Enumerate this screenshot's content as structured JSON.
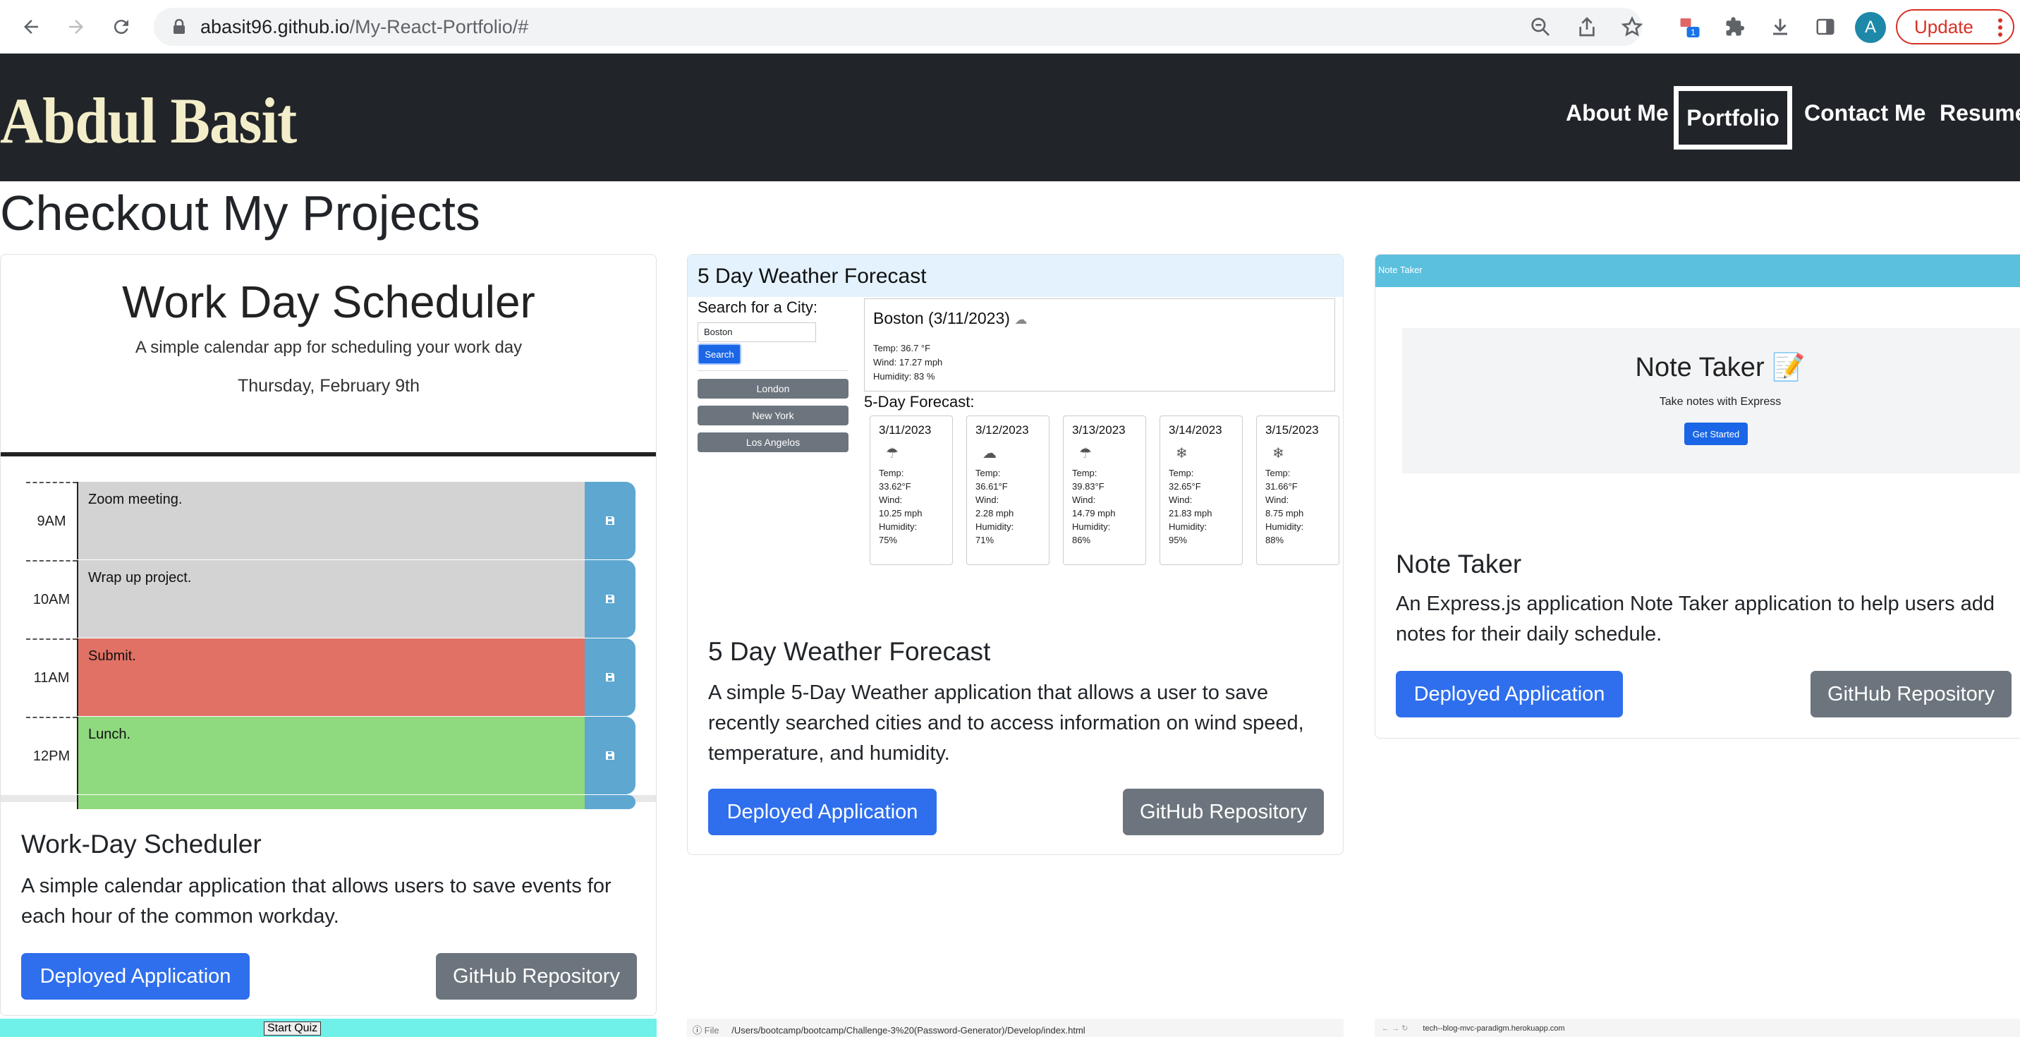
{
  "browser": {
    "url_host": "abasit96.github.io",
    "url_path": "/My-React-Portfolio/#",
    "avatar_letter": "A",
    "update_label": "Update",
    "extension_badge": "1"
  },
  "site": {
    "logo": "Abdul Basit",
    "nav": [
      "About Me",
      "Portfolio",
      "Contact Me",
      "Resume"
    ],
    "page_title": "Checkout My Projects"
  },
  "projects": [
    {
      "title": "Work-Day Scheduler",
      "description": "A simple calendar application that allows users to save events for each hour of the common workday.",
      "deploy_label": "Deployed Application",
      "repo_label": "GitHub Repository",
      "preview": {
        "title": "Work Day Scheduler",
        "subtitle": "A simple calendar app for scheduling your work day",
        "date": "Thursday, February 9th",
        "rows": [
          {
            "hour": "9AM",
            "text": "Zoom meeting.",
            "color": "#d3d3d3"
          },
          {
            "hour": "10AM",
            "text": "Wrap up project.",
            "color": "#d3d3d3"
          },
          {
            "hour": "11AM",
            "text": "Submit.",
            "color": "#e17165"
          },
          {
            "hour": "12PM",
            "text": "Lunch.",
            "color": "#8fd97f"
          }
        ]
      }
    },
    {
      "title": "5 Day Weather Forecast",
      "description": "A simple 5-Day Weather application that allows a user to save recently searched cities and to access information on wind speed, temperature, and humidity.",
      "deploy_label": "Deployed Application",
      "repo_label": "GitHub Repository",
      "preview": {
        "header": "5 Day Weather Forecast",
        "search_label": "Search for a City:",
        "search_value": "Boston",
        "search_button": "Search",
        "cities": [
          "London",
          "New York",
          "Los Angelos"
        ],
        "current_title": "Boston (3/11/2023)",
        "current_temp": "Temp: 36.7 °F",
        "current_wind": "Wind: 17.27 mph",
        "current_humidity": "Humidity: 83 %",
        "forecast_label": "5-Day Forecast:",
        "forecast": [
          {
            "date": "3/11/2023",
            "temp": "33.62°F",
            "wind": "10.25 mph",
            "humidity": "75%"
          },
          {
            "date": "3/12/2023",
            "temp": "36.61°F",
            "wind": "2.28 mph",
            "humidity": "71%"
          },
          {
            "date": "3/13/2023",
            "temp": "39.83°F",
            "wind": "14.79 mph",
            "humidity": "86%"
          },
          {
            "date": "3/14/2023",
            "temp": "32.65°F",
            "wind": "21.83 mph",
            "humidity": "95%"
          },
          {
            "date": "3/15/2023",
            "temp": "31.66°F",
            "wind": "8.75 mph",
            "humidity": "88%"
          }
        ]
      }
    },
    {
      "title": "Note Taker",
      "description": "An Express.js application Note Taker application to help users add notes for their daily schedule.",
      "deploy_label": "Deployed Application",
      "repo_label": "GitHub Repository",
      "preview": {
        "bar": "Note Taker",
        "title": "Note Taker 📝",
        "subtitle": "Take notes with Express",
        "button": "Get Started"
      }
    }
  ],
  "peeks": {
    "quiz_button": "Start Quiz",
    "file_url": "/Users/bootcamp/bootcamp/Challenge-3%20(Password-Generator)/Develop/index.html",
    "file_scheme": "File",
    "blog_url": "tech--blog-mvc-paradigm.herokuapp.com"
  }
}
